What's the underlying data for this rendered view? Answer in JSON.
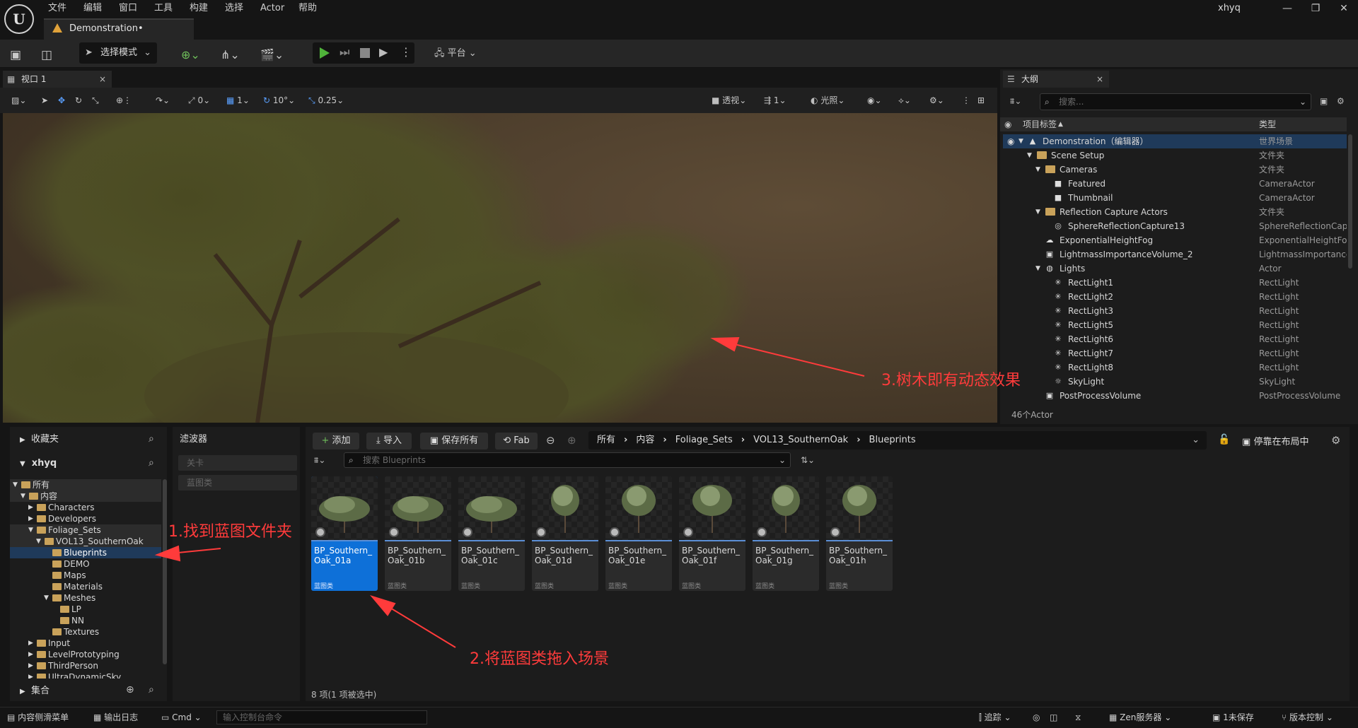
{
  "app": {
    "menus": [
      "文件",
      "编辑",
      "窗口",
      "工具",
      "构建",
      "选择",
      "Actor",
      "帮助"
    ],
    "user": "xhyq",
    "document_tab": "Demonstration•"
  },
  "toolbar": {
    "mode": "选择模式",
    "platform": "平台"
  },
  "viewport": {
    "tab": "视口 1",
    "snap_rot": "0",
    "snap_grid": "1",
    "snap_angle": "10°",
    "snap_scale": "0.25",
    "perspective": "透视",
    "cam_speed": "1",
    "lighting": "光照"
  },
  "outliner": {
    "tab": "大纲",
    "search_placeholder": "搜索...",
    "col_label": "项目标签",
    "col_type": "类型",
    "footer": "46个Actor",
    "rows": [
      {
        "label": "Demonstration（编辑器）",
        "type": "世界场景",
        "indent": 0,
        "icon": "level",
        "sel": true,
        "exp": true
      },
      {
        "label": "Scene Setup",
        "type": "文件夹",
        "indent": 1,
        "icon": "folder",
        "exp": true
      },
      {
        "label": "Cameras",
        "type": "文件夹",
        "indent": 2,
        "icon": "folder",
        "exp": true
      },
      {
        "label": "Featured",
        "type": "CameraActor",
        "indent": 3,
        "icon": "camera"
      },
      {
        "label": "Thumbnail",
        "type": "CameraActor",
        "indent": 3,
        "icon": "camera"
      },
      {
        "label": "Reflection Capture Actors",
        "type": "文件夹",
        "indent": 2,
        "icon": "folder",
        "exp": true
      },
      {
        "label": "SphereReflectionCapture13",
        "type": "SphereReflectionCapt",
        "indent": 3,
        "icon": "sphere"
      },
      {
        "label": "ExponentialHeightFog",
        "type": "ExponentialHeightFog",
        "indent": 2,
        "icon": "fog"
      },
      {
        "label": "LightmassImportanceVolume_2",
        "type": "LightmassImportance",
        "indent": 2,
        "icon": "volume"
      },
      {
        "label": "Lights",
        "type": "Actor",
        "indent": 2,
        "icon": "actor",
        "exp": true
      },
      {
        "label": "RectLight1",
        "type": "RectLight",
        "indent": 3,
        "icon": "light"
      },
      {
        "label": "RectLight2",
        "type": "RectLight",
        "indent": 3,
        "icon": "light"
      },
      {
        "label": "RectLight3",
        "type": "RectLight",
        "indent": 3,
        "icon": "light"
      },
      {
        "label": "RectLight5",
        "type": "RectLight",
        "indent": 3,
        "icon": "light"
      },
      {
        "label": "RectLight6",
        "type": "RectLight",
        "indent": 3,
        "icon": "light"
      },
      {
        "label": "RectLight7",
        "type": "RectLight",
        "indent": 3,
        "icon": "light"
      },
      {
        "label": "RectLight8",
        "type": "RectLight",
        "indent": 3,
        "icon": "light"
      },
      {
        "label": "SkyLight",
        "type": "SkyLight",
        "indent": 3,
        "icon": "sky"
      },
      {
        "label": "PostProcessVolume",
        "type": "PostProcessVolume",
        "indent": 2,
        "icon": "volume"
      }
    ]
  },
  "content_browser": {
    "favorites": "收藏夹",
    "project": "xhyq",
    "collections": "集合",
    "filters": "滤波器",
    "filter_items": [
      "关卡",
      "蓝图类"
    ],
    "tree": [
      {
        "label": "所有",
        "indent": 0,
        "exp": true,
        "selpar": true
      },
      {
        "label": "内容",
        "indent": 1,
        "exp": true,
        "selpar": true
      },
      {
        "label": "Characters",
        "indent": 2,
        "col": true
      },
      {
        "label": "Developers",
        "indent": 2,
        "col": true
      },
      {
        "label": "Foliage_Sets",
        "indent": 2,
        "exp": true,
        "selpar": true
      },
      {
        "label": "VOL13_SouthernOak",
        "indent": 3,
        "exp": true,
        "selpar": true
      },
      {
        "label": "Blueprints",
        "indent": 4,
        "sel": true
      },
      {
        "label": "DEMO",
        "indent": 4
      },
      {
        "label": "Maps",
        "indent": 4
      },
      {
        "label": "Materials",
        "indent": 4
      },
      {
        "label": "Meshes",
        "indent": 4,
        "exp": true
      },
      {
        "label": "LP",
        "indent": 5
      },
      {
        "label": "NN",
        "indent": 5
      },
      {
        "label": "Textures",
        "indent": 4
      },
      {
        "label": "Input",
        "indent": 2,
        "col": true
      },
      {
        "label": "LevelPrototyping",
        "indent": 2,
        "col": true
      },
      {
        "label": "ThirdPerson",
        "indent": 2,
        "col": true
      },
      {
        "label": "UltraDynamicSky",
        "indent": 2,
        "col": true
      }
    ],
    "buttons": {
      "add": "添加",
      "import": "导入",
      "save_all": "保存所有",
      "fab": "Fab",
      "dock": "停靠在布局中"
    },
    "path": [
      "所有",
      "内容",
      "Foliage_Sets",
      "VOL13_SouthernOak",
      "Blueprints"
    ],
    "search_placeholder": "搜索 Blueprints",
    "assets": [
      {
        "name": "BP_Southern_Oak_01a",
        "type": "蓝图类",
        "sel": true
      },
      {
        "name": "BP_Southern_Oak_01b",
        "type": "蓝图类"
      },
      {
        "name": "BP_Southern_Oak_01c",
        "type": "蓝图类"
      },
      {
        "name": "BP_Southern_Oak_01d",
        "type": "蓝图类"
      },
      {
        "name": "BP_Southern_Oak_01e",
        "type": "蓝图类"
      },
      {
        "name": "BP_Southern_Oak_01f",
        "type": "蓝图类"
      },
      {
        "name": "BP_Southern_Oak_01g",
        "type": "蓝图类"
      },
      {
        "name": "BP_Southern_Oak_01h",
        "type": "蓝图类"
      }
    ],
    "count": "8 项(1 项被选中)"
  },
  "annotations": {
    "a1": "1.找到蓝图文件夹",
    "a2": "2.将蓝图类拖入场景",
    "a3": "3.树木即有动态效果",
    "color": "#ff3b3b"
  },
  "statusbar": {
    "drawer": "内容侧滑菜单",
    "log": "输出日志",
    "cmd": "Cmd",
    "console_placeholder": "输入控制台命令",
    "trace": "追踪",
    "zen": "Zen服务器",
    "unsaved": "1未保存",
    "vcs": "版本控制"
  }
}
